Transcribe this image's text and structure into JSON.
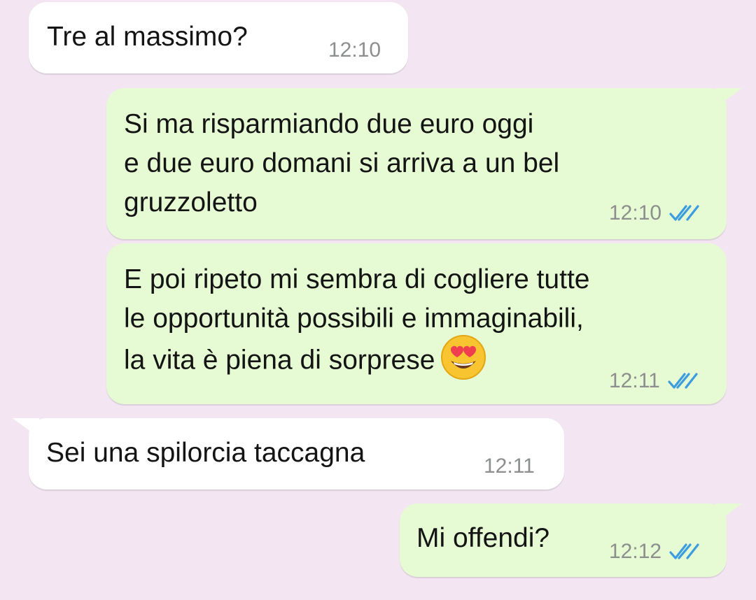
{
  "conversation": {
    "messages": [
      {
        "direction": "incoming",
        "text": "Tre al massimo?",
        "time": "12:10",
        "status": ""
      },
      {
        "direction": "outgoing",
        "text": "Si ma risparmiando due euro oggi\ne due euro domani si arriva a un bel\ngruzzoletto",
        "time": "12:10",
        "status": "read"
      },
      {
        "direction": "outgoing",
        "text": "E poi ripeto mi sembra di cogliere tutte\nle opportunità possibili e immaginabili,\nla vita è piena di sorprese",
        "time": "12:11",
        "status": "read",
        "emoji": "smiling-face-with-heart-eyes"
      },
      {
        "direction": "incoming",
        "text": "Sei una spilorcia taccagna",
        "time": "12:11",
        "status": ""
      },
      {
        "direction": "outgoing",
        "text": "Mi offendi?",
        "time": "12:12",
        "status": "read"
      }
    ]
  },
  "colors": {
    "background": "#f3e6f2",
    "incoming_bubble": "#ffffff",
    "outgoing_bubble": "#e6fbd4",
    "timestamp": "#8c8f8d",
    "read_ticks": "#3b9ce0"
  }
}
